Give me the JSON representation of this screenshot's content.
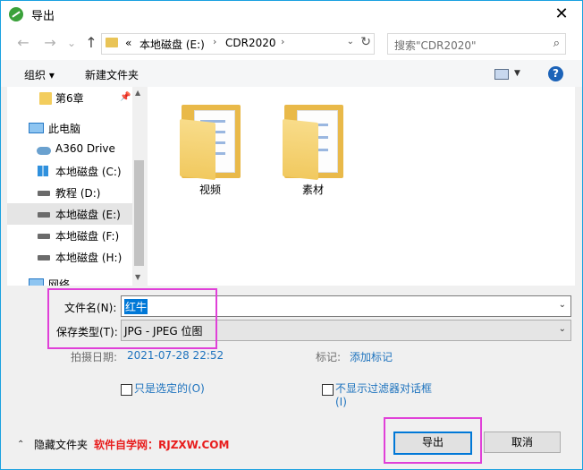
{
  "window": {
    "title": "导出",
    "close_glyph": "✕"
  },
  "nav_buttons": {
    "back": "←",
    "forward": "→",
    "recent": "⌄",
    "up": "↑"
  },
  "address": {
    "overflow": "«",
    "segments": [
      "本地磁盘 (E:)",
      "CDR2020"
    ],
    "separator": "›",
    "dropdown_glyph": "⌄",
    "refresh_glyph": "↻"
  },
  "search": {
    "placeholder": "搜索\"CDR2020\"",
    "icon_glyph": "⌕"
  },
  "toolbar": {
    "organize": "组织 ▾",
    "new_folder": "新建文件夹",
    "view_dd": "▼",
    "help": "?"
  },
  "sidebar": {
    "items": [
      {
        "label": "第6章",
        "icon": "folder-icon",
        "pinned": true
      },
      {
        "label": "此电脑",
        "icon": "pc-icon"
      },
      {
        "label": "A360 Drive",
        "icon": "cloud-icon"
      },
      {
        "label": "本地磁盘 (C:)",
        "icon": "windows-drive-icon"
      },
      {
        "label": "教程 (D:)",
        "icon": "drive-icon"
      },
      {
        "label": "本地磁盘 (E:)",
        "icon": "drive-icon",
        "selected": true
      },
      {
        "label": "本地磁盘 (F:)",
        "icon": "drive-icon"
      },
      {
        "label": "本地磁盘 (H:)",
        "icon": "drive-icon"
      },
      {
        "label": "网络",
        "icon": "network-icon"
      }
    ],
    "pin_glyph": "📌",
    "scroll_up": "▲",
    "scroll_down": "▼"
  },
  "files": [
    {
      "label": "视频",
      "icon": "folder-icon"
    },
    {
      "label": "素材",
      "icon": "folder-icon"
    }
  ],
  "form": {
    "filename_label": "文件名(N):",
    "filename_value": "红牛",
    "filetype_label": "保存类型(T):",
    "filetype_value": "JPG - JPEG 位图",
    "date_label": "拍摄日期:",
    "date_value": "2021-07-28 22:52",
    "tags_label": "标记:",
    "tags_value": "添加标记",
    "selected_only_label": "只是选定的(O)",
    "no_filter_label_1": "不显示过滤器对话框",
    "no_filter_label_2": "(I)",
    "dd_glyph": "⌄"
  },
  "footer": {
    "hide_folders": "隐藏文件夹",
    "hide_chevron": "⌃",
    "watermark": "软件自学网：RJZXW.COM",
    "export_button": "导出",
    "cancel_button": "取消"
  },
  "colors": {
    "accent": "#0078d7",
    "annotation": "#e040d8",
    "watermark": "#e81c1c",
    "link": "#1e73be"
  }
}
